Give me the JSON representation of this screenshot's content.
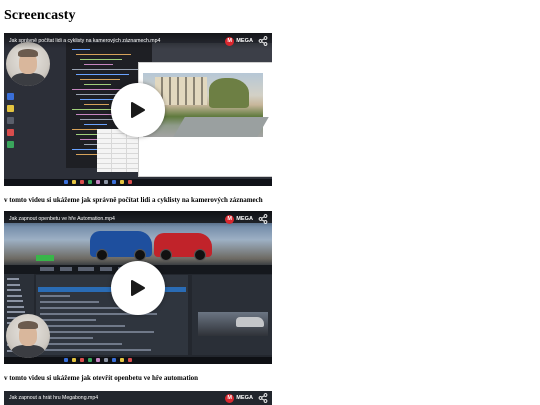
{
  "page": {
    "title": "Screencasty"
  },
  "brand": {
    "name": "MEGA",
    "logo_letter": "M",
    "color": "#d9272e"
  },
  "videos": [
    {
      "title": "Jak správně počítat lidi a cyklisty na kamerových záznamech.mp4",
      "caption": "v tomto videu si ukážeme jak správně počítat lidi a cyklisty na kamerových záznamech"
    },
    {
      "title": "Jak zapnout openbetu ve hře Automation.mp4",
      "caption": "v tomto videu si ukážeme jak otevřít openbetu ve hře automation"
    },
    {
      "title": "Jak zapnout a hrát hru Megabong.mp4"
    }
  ],
  "icons": {
    "play": "play-icon",
    "share": "share-icon",
    "mega_logo": "mega-logo-icon"
  }
}
